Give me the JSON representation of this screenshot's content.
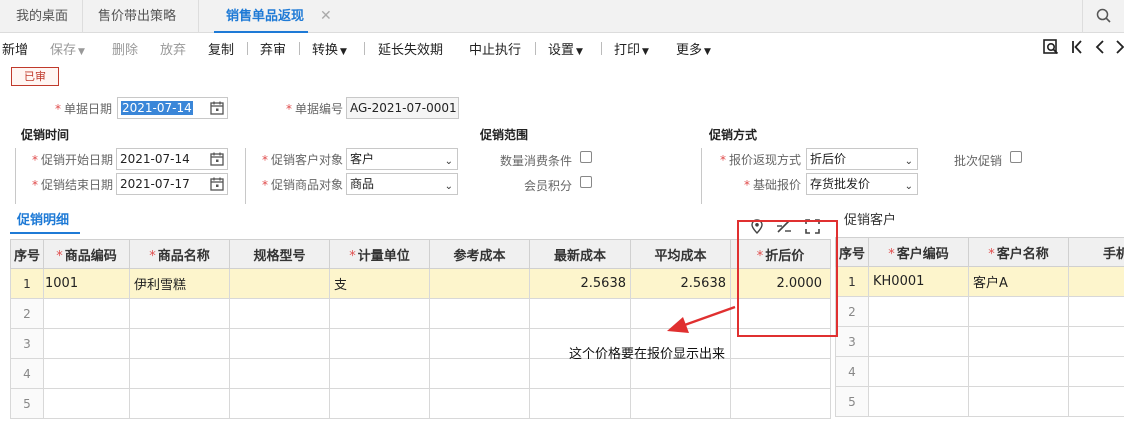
{
  "tabs": [
    {
      "label": "我的桌面"
    },
    {
      "label": "售价带出策略"
    },
    {
      "label": "销售单品返现",
      "close": "✕"
    }
  ],
  "toolbar": {
    "new": "新增",
    "save": "保存",
    "delete": "删除",
    "discard": "放弃",
    "copy": "复制",
    "unaudit": "弃审",
    "convert": "转换",
    "extend": "延长失效期",
    "stop": "中止执行",
    "settings": "设置",
    "print": "打印",
    "more": "更多"
  },
  "status": "已审",
  "form": {
    "doc_date_label": "单据日期",
    "doc_date": "2021-07-14",
    "doc_no_label": "单据编号",
    "doc_no": "AG-2021-07-0001",
    "section_time": "促销时间",
    "section_scope": "促销范围",
    "section_mode": "促销方式",
    "start_label": "促销开始日期",
    "start": "2021-07-14",
    "end_label": "促销结束日期",
    "end": "2021-07-17",
    "cust_obj_label": "促销客户对象",
    "cust_obj": "客户",
    "goods_obj_label": "促销商品对象",
    "goods_obj": "商品",
    "qty_cond_label": "数量消费条件",
    "member_pts_label": "会员积分",
    "quote_mode_label": "报价返现方式",
    "quote_mode": "折后价",
    "base_price_label": "基础报价",
    "base_price": "存货批发价",
    "batch_label": "批次促销"
  },
  "detail": {
    "tab_label": "促销明细",
    "headers": [
      "序号",
      "商品编码",
      "商品名称",
      "规格型号",
      "计量单位",
      "参考成本",
      "最新成本",
      "平均成本",
      "折后价"
    ],
    "rows": [
      {
        "idx": "1",
        "code": "1001",
        "name": "伊利雪糕",
        "spec": "",
        "unit": "支",
        "ref": "",
        "latest": "2.5638",
        "avg": "2.5638",
        "price": "2.0000"
      },
      {
        "idx": "2"
      },
      {
        "idx": "3"
      },
      {
        "idx": "4"
      },
      {
        "idx": "5"
      }
    ]
  },
  "customer": {
    "tab_label": "促销客户",
    "headers": [
      "序号",
      "客户编码",
      "客户名称",
      "手机"
    ],
    "rows": [
      {
        "idx": "1",
        "code": "KH0001",
        "name": "客户A",
        "phone": ""
      },
      {
        "idx": "2"
      },
      {
        "idx": "3"
      },
      {
        "idx": "4"
      },
      {
        "idx": "5"
      }
    ]
  },
  "annotation": "这个价格要在报价显示出来",
  "colors": {
    "accent": "#1e7ad6",
    "highlight_row": "#fdf5cc",
    "annotation_red": "#e03030"
  }
}
